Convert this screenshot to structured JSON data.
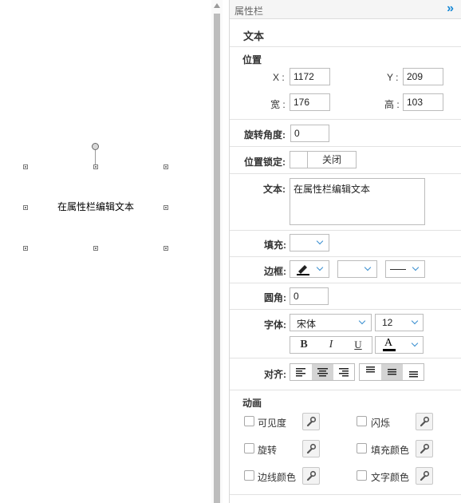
{
  "canvas": {
    "shape_text": "在属性栏编辑文本"
  },
  "panel": {
    "title": "属性栏",
    "collapse_glyph": "»",
    "section_title": "文本",
    "position": {
      "heading": "位置",
      "x_label": "X :",
      "x_value": "1172",
      "y_label": "Y :",
      "y_value": "209",
      "w_label": "宽 :",
      "w_value": "176",
      "h_label": "高 :",
      "h_value": "103"
    },
    "rotation": {
      "label": "旋转角度:",
      "value": "0"
    },
    "lock": {
      "label": "位置锁定:",
      "state": "关闭"
    },
    "text": {
      "label": "文本:",
      "value": "在属性栏编辑文本"
    },
    "fill": {
      "label": "填充:"
    },
    "border": {
      "label": "边框:"
    },
    "radius": {
      "label": "圆角:",
      "value": "0"
    },
    "font": {
      "label": "字体:",
      "family": "宋体",
      "size": "12",
      "bold": "B",
      "italic": "I",
      "underline": "U",
      "color_letter": "A"
    },
    "align": {
      "label": "对齐:",
      "horizontal_selected": "center",
      "vertical_selected": "middle"
    },
    "animation": {
      "heading": "动画",
      "items": [
        {
          "label": "可见度"
        },
        {
          "label": "闪烁"
        },
        {
          "label": "旋转"
        },
        {
          "label": "填充颜色"
        },
        {
          "label": "边线颜色"
        },
        {
          "label": "文字颜色"
        }
      ]
    }
  },
  "icons": {
    "collapse": "double-chevron-right-icon",
    "pen": "pen-icon",
    "wrench": "wrench-icon",
    "font_color": "font-color-icon"
  },
  "colors": {
    "accent": "#1a8ad6",
    "active_button": "#d4d4d4",
    "panel_header": "#f5f5f5"
  }
}
